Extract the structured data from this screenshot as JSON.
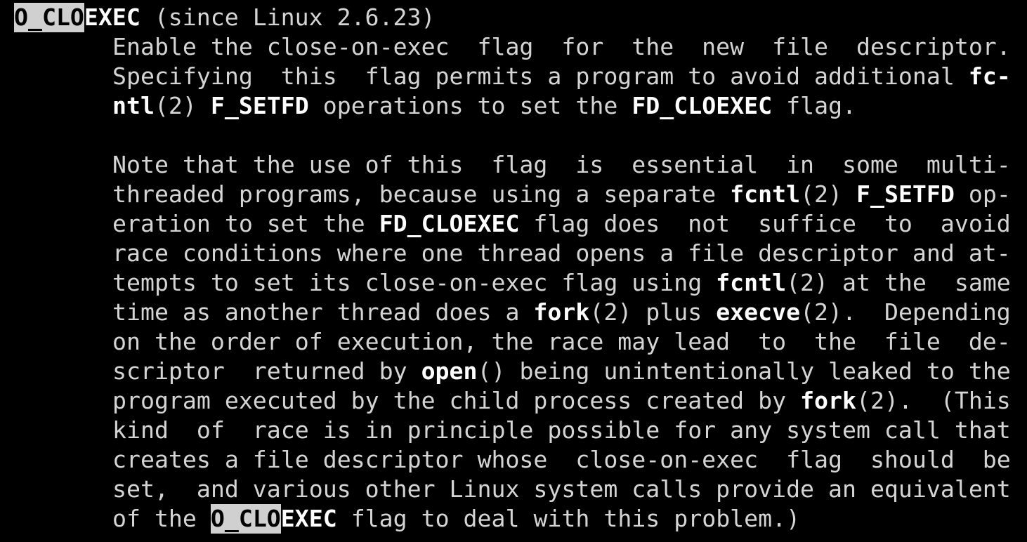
{
  "window": {
    "type": "terminal-man-page",
    "search_term": "O_CLO",
    "colors": {
      "background": "#000000",
      "text": "#d4d4d4",
      "bold": "#ffffff",
      "highlight_bg": "#d0d0d0",
      "highlight_fg": "#000000"
    }
  },
  "lines": [
    {
      "indent": 0,
      "segments": [
        {
          "t": "O_CLO",
          "s": "hl"
        },
        {
          "t": "EXEC",
          "s": "bold"
        },
        {
          "t": " (since Linux 2.6.23)",
          "s": "plain"
        }
      ]
    },
    {
      "indent": 7,
      "segments": [
        {
          "t": "Enable the close-on-exec  flag  for  the  new  file  descriptor.",
          "s": "plain"
        }
      ]
    },
    {
      "indent": 7,
      "segments": [
        {
          "t": "Specifying  this  flag permits a program to avoid additional ",
          "s": "plain"
        },
        {
          "t": "fc-",
          "s": "bold"
        }
      ]
    },
    {
      "indent": 7,
      "segments": [
        {
          "t": "ntl",
          "s": "bold"
        },
        {
          "t": "(2) ",
          "s": "plain"
        },
        {
          "t": "F_SETFD",
          "s": "bold"
        },
        {
          "t": " operations to set the ",
          "s": "plain"
        },
        {
          "t": "FD_CLOEXEC",
          "s": "bold"
        },
        {
          "t": " flag.",
          "s": "plain"
        }
      ]
    },
    {
      "indent": 0,
      "segments": [
        {
          "t": "",
          "s": "plain"
        }
      ]
    },
    {
      "indent": 7,
      "segments": [
        {
          "t": "Note that the use of this  flag  is  essential  in  some  multi-",
          "s": "plain"
        }
      ]
    },
    {
      "indent": 7,
      "segments": [
        {
          "t": "threaded programs, because using a separate ",
          "s": "plain"
        },
        {
          "t": "fcntl",
          "s": "bold"
        },
        {
          "t": "(2) ",
          "s": "plain"
        },
        {
          "t": "F_SETFD",
          "s": "bold"
        },
        {
          "t": " op-",
          "s": "plain"
        }
      ]
    },
    {
      "indent": 7,
      "segments": [
        {
          "t": "eration to set the ",
          "s": "plain"
        },
        {
          "t": "FD_CLOEXEC",
          "s": "bold"
        },
        {
          "t": " flag does  not  suffice  to  avoid",
          "s": "plain"
        }
      ]
    },
    {
      "indent": 7,
      "segments": [
        {
          "t": "race conditions where one thread opens a file descriptor and at-",
          "s": "plain"
        }
      ]
    },
    {
      "indent": 7,
      "segments": [
        {
          "t": "tempts to set its close-on-exec flag using ",
          "s": "plain"
        },
        {
          "t": "fcntl",
          "s": "bold"
        },
        {
          "t": "(2) at the  same",
          "s": "plain"
        }
      ]
    },
    {
      "indent": 7,
      "segments": [
        {
          "t": "time as another thread does a ",
          "s": "plain"
        },
        {
          "t": "fork",
          "s": "bold"
        },
        {
          "t": "(2) plus ",
          "s": "plain"
        },
        {
          "t": "execve",
          "s": "bold"
        },
        {
          "t": "(2).  Depending",
          "s": "plain"
        }
      ]
    },
    {
      "indent": 7,
      "segments": [
        {
          "t": "on the order of execution, the race may lead  to  the  file  de-",
          "s": "plain"
        }
      ]
    },
    {
      "indent": 7,
      "segments": [
        {
          "t": "scriptor  returned by ",
          "s": "plain"
        },
        {
          "t": "open",
          "s": "bold"
        },
        {
          "t": "() being unintentionally leaked to the",
          "s": "plain"
        }
      ]
    },
    {
      "indent": 7,
      "segments": [
        {
          "t": "program executed by the child process created by ",
          "s": "plain"
        },
        {
          "t": "fork",
          "s": "bold"
        },
        {
          "t": "(2).  (This",
          "s": "plain"
        }
      ]
    },
    {
      "indent": 7,
      "segments": [
        {
          "t": "kind  of  race is in principle possible for any system call that",
          "s": "plain"
        }
      ]
    },
    {
      "indent": 7,
      "segments": [
        {
          "t": "creates a file descriptor whose  close-on-exec  flag  should  be",
          "s": "plain"
        }
      ]
    },
    {
      "indent": 7,
      "segments": [
        {
          "t": "set,  and various other Linux system calls provide an equivalent",
          "s": "plain"
        }
      ]
    },
    {
      "indent": 7,
      "segments": [
        {
          "t": "of the ",
          "s": "plain"
        },
        {
          "t": "O_CLO",
          "s": "hl"
        },
        {
          "t": "EXEC",
          "s": "bold"
        },
        {
          "t": " flag to deal with this problem.)",
          "s": "plain"
        }
      ]
    }
  ]
}
